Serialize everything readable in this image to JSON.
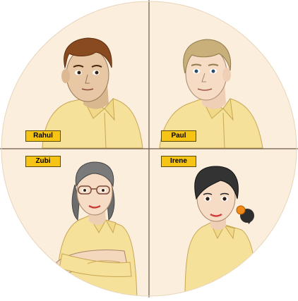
{
  "colors": {
    "background": "#fbeedd",
    "divider": "#6b5a45",
    "shirt": "#f6e19a",
    "shirt_shadow": "#e7c96a",
    "label_fill": "#f6c415",
    "skin": "#f3d8bd"
  },
  "people": [
    {
      "name": "Rahul",
      "hair": "brown"
    },
    {
      "name": "Paul",
      "hair": "blond"
    },
    {
      "name": "Zubi",
      "hair": "grey",
      "accessory": "glasses"
    },
    {
      "name": "Irene",
      "hair": "black",
      "accessory": "orange-hair-tie"
    }
  ]
}
